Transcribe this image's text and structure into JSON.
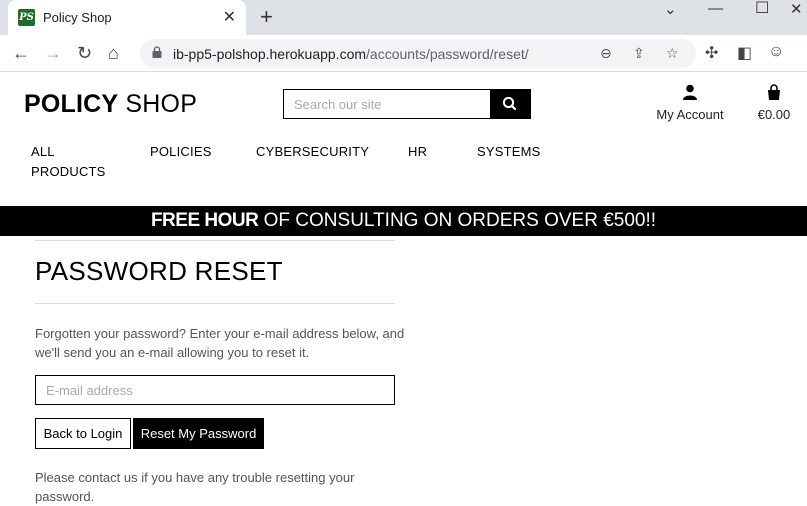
{
  "browser": {
    "tab_title": "Policy Shop",
    "favicon_text": "PS",
    "url_host": "ib-pp5-polshop.herokuapp.com",
    "url_path": "/accounts/password/reset/"
  },
  "header": {
    "logo_bold": "POLICY",
    "logo_rest": " SHOP",
    "search_placeholder": "Search our site",
    "account_label": "My Account",
    "bag_total": "€0.00"
  },
  "nav": {
    "items": [
      {
        "label": "ALL PRODUCTS"
      },
      {
        "label": "POLICIES"
      },
      {
        "label": "CYBERSECURITY"
      },
      {
        "label": "HR"
      },
      {
        "label": "SYSTEMS"
      }
    ]
  },
  "banner": {
    "bold": "FREE HOUR",
    "rest": " OF CONSULTING ON ORDERS OVER €500!!"
  },
  "main": {
    "heading": "PASSWORD RESET",
    "intro": "Forgotten your password? Enter your e-mail address below, and we'll send you an e-mail allowing you to reset it.",
    "email_placeholder": "E-mail address",
    "back_label": "Back to Login",
    "reset_label": "Reset My Password",
    "help": "Please contact us if you have any trouble resetting your password."
  },
  "colors": {
    "accent": "#000000",
    "favicon": "#1e6b2a"
  }
}
